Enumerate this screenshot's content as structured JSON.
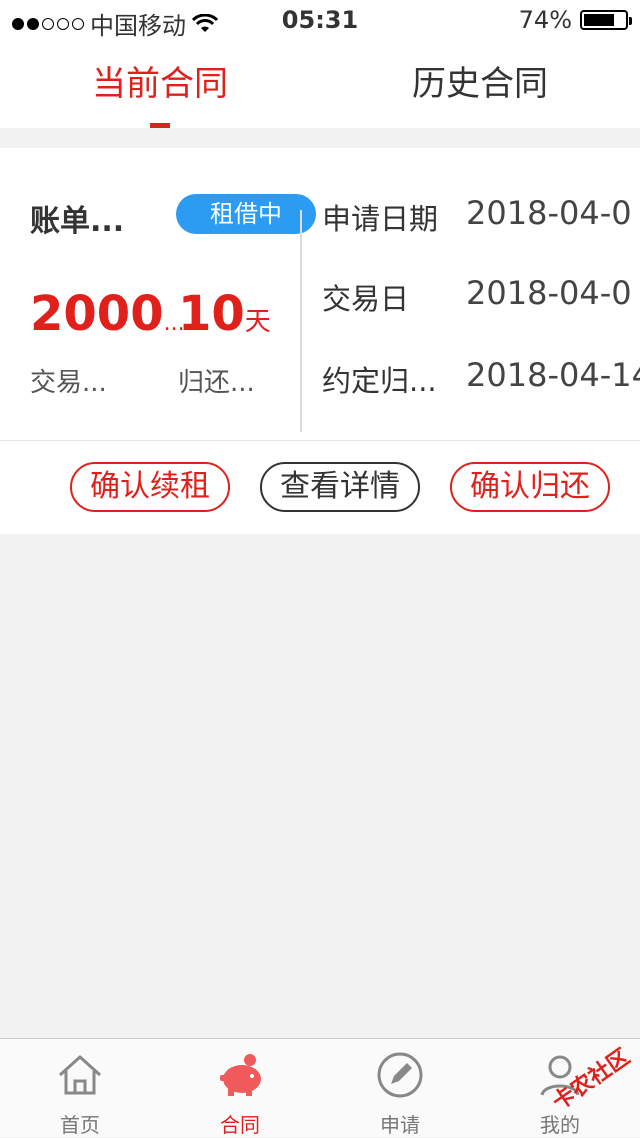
{
  "statusbar": {
    "carrier": "中国移动",
    "time": "05:31",
    "battery": "74%"
  },
  "tabs": [
    {
      "label": "当前合同",
      "active": true
    },
    {
      "label": "历史合同",
      "active": false
    }
  ],
  "contract": {
    "title": "账单...",
    "status": "租借中",
    "amount": "2000",
    "amount_suffix": "...",
    "amount_label": "交易...",
    "days": "10",
    "days_unit": "天",
    "days_label": "归还...",
    "info": [
      {
        "label": "申请日期",
        "value": "2018-04-0"
      },
      {
        "label": "交易日",
        "value": "2018-04-0"
      },
      {
        "label": "约定归...",
        "value": "2018-04-14"
      }
    ],
    "buttons": {
      "renew": "确认续租",
      "details": "查看详情",
      "return": "确认归还"
    }
  },
  "tabbar": [
    {
      "label": "首页",
      "icon": "home-icon"
    },
    {
      "label": "合同",
      "icon": "piggy-bank-icon",
      "active": true
    },
    {
      "label": "申请",
      "icon": "pencil-icon"
    },
    {
      "label": "我的",
      "icon": "user-icon"
    }
  ],
  "watermark": "卡农社区",
  "colors": {
    "accent": "#e0201b",
    "badge": "#2b9cf2"
  },
  "battery_level": 0.74
}
